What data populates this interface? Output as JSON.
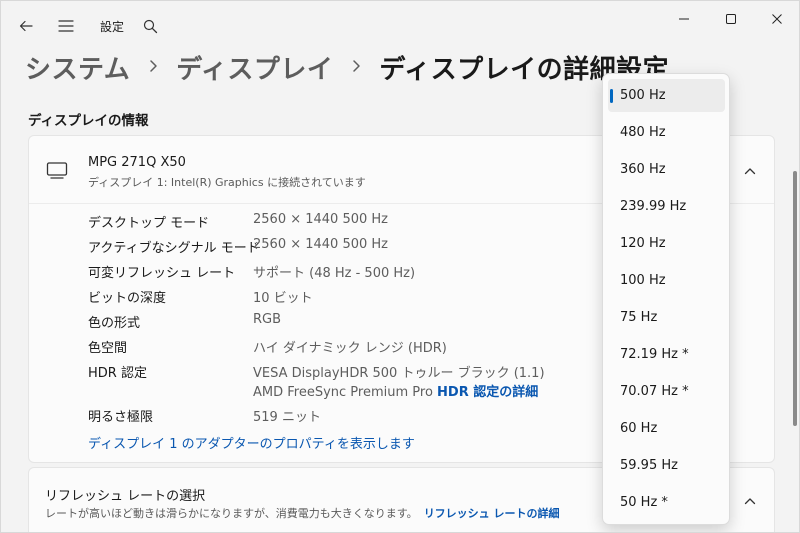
{
  "titlebar": {
    "title": "設定"
  },
  "breadcrumb": {
    "items": [
      "システム",
      "ディスプレイ",
      "ディスプレイの詳細設定"
    ]
  },
  "section": {
    "title": "ディスプレイの情報"
  },
  "display": {
    "name": "MPG 271Q X50",
    "subtitle": "ディスプレイ 1: Intel(R) Graphics に接続されています",
    "properties": [
      {
        "label": "デスクトップ モード",
        "value": "2560 × 1440 500 Hz"
      },
      {
        "label": "アクティブなシグナル モード",
        "value": "2560 × 1440 500 Hz"
      },
      {
        "label": "可変リフレッシュ レート",
        "value": "サポート (48 Hz - 500 Hz)"
      },
      {
        "label": "ビットの深度",
        "value": "10 ビット"
      },
      {
        "label": "色の形式",
        "value": "RGB"
      },
      {
        "label": "色空間",
        "value": "ハイ ダイナミック レンジ (HDR)"
      },
      {
        "label": "HDR 認定",
        "value": "VESA DisplayHDR 500 トゥルー ブラック (1.1)",
        "value2": "AMD FreeSync Premium Pro",
        "link": "HDR 認定の詳細"
      },
      {
        "label": "明るさ極限",
        "value": "519 ニット"
      }
    ],
    "adapter_link": "ディスプレイ 1 のアダプターのプロパティを表示します"
  },
  "refresh": {
    "title": "リフレッシュ レートの選択",
    "desc": "レートが高いほど動きは滑らかになりますが、消費電力も大きくなります。",
    "link": "リフレッシュ レートの詳細"
  },
  "dropdown": {
    "options": [
      "500 Hz",
      "480 Hz",
      "360 Hz",
      "239.99 Hz",
      "120 Hz",
      "100 Hz",
      "75 Hz",
      "72.19 Hz *",
      "70.07 Hz *",
      "60 Hz",
      "59.95 Hz",
      "50 Hz *"
    ],
    "selected": "500 Hz"
  },
  "colors": {
    "accent": "#0067c0",
    "link": "#0a57b0",
    "background": "#f3f3f3",
    "card": "#fbfbfb"
  },
  "icons": [
    "back-arrow-icon",
    "hamburger-menu-icon",
    "search-icon",
    "minimize-icon",
    "maximize-icon",
    "close-icon",
    "monitor-icon",
    "chevron-up-icon"
  ]
}
